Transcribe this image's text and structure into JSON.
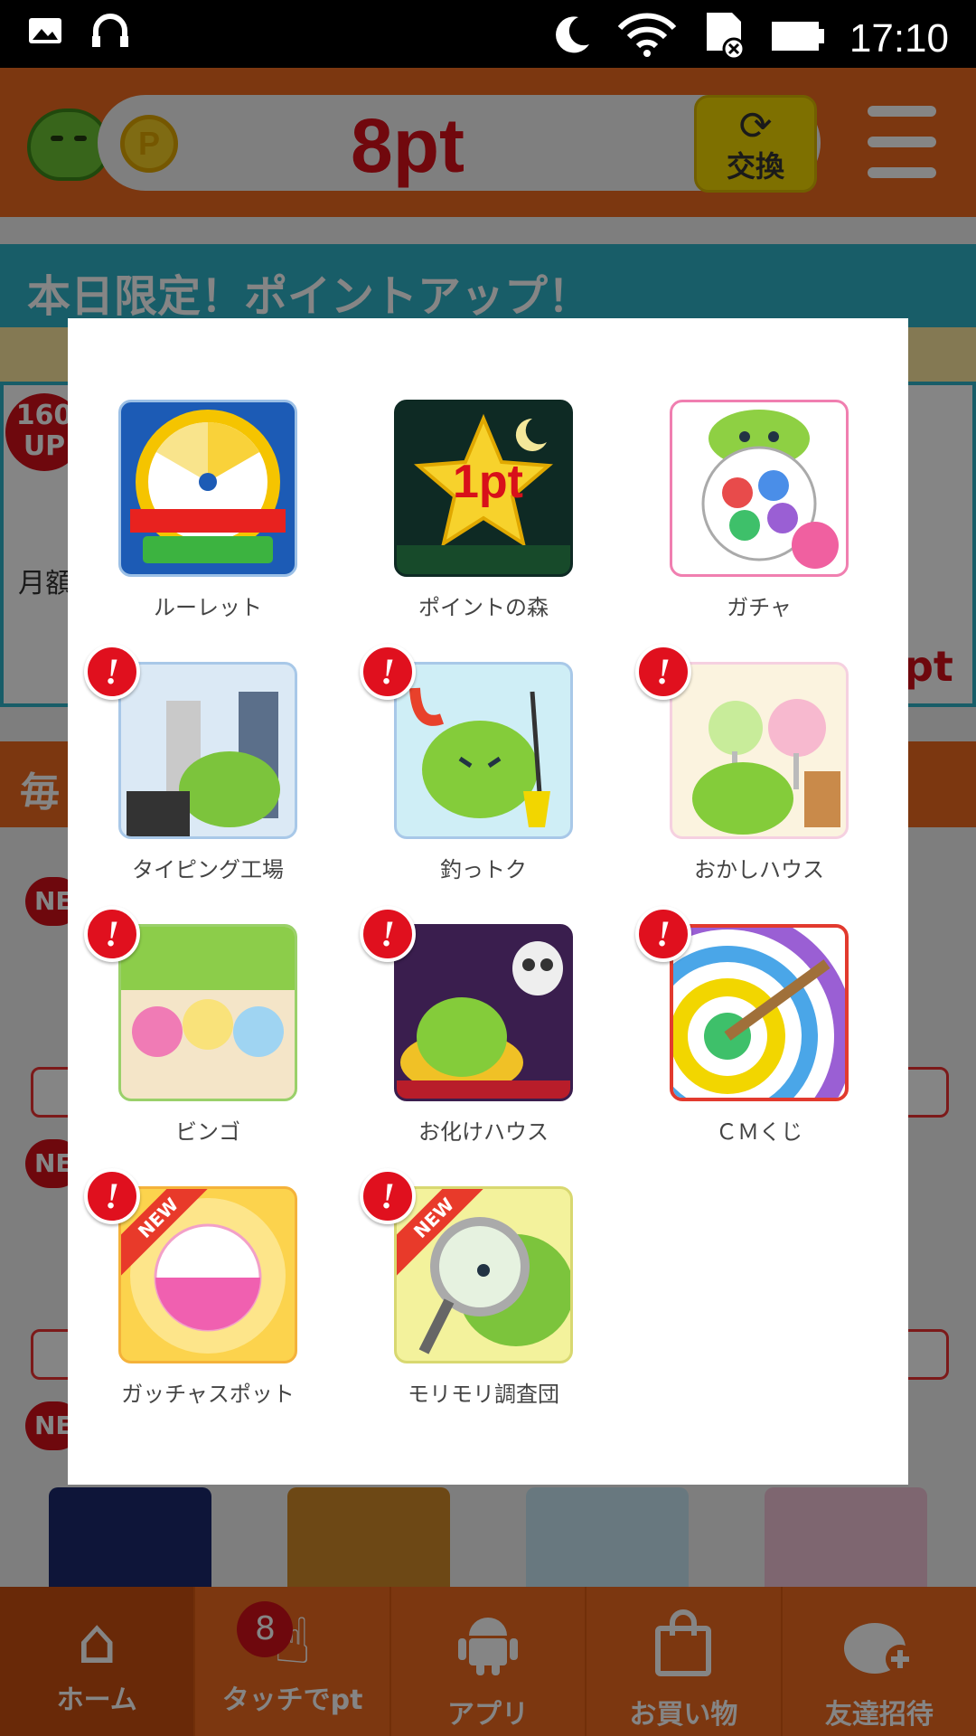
{
  "status_bar": {
    "time": "17:10"
  },
  "header": {
    "points": "8pt",
    "coin_symbol": "P",
    "exchange_label": "交換"
  },
  "background": {
    "banner_title": "本日限定！ポイントアップ！",
    "badge_160": "160\nUP",
    "monthly_text": "月額",
    "section2_title": "毎",
    "pt_fragment": "pt",
    "new_badge": "NE"
  },
  "modal": {
    "items": [
      {
        "label": "ルーレット",
        "alert": false,
        "new": false,
        "colors": [
          "#1c5bb5",
          "#f5c400"
        ]
      },
      {
        "label": "ポイントの森",
        "alert": false,
        "new": false,
        "colors": [
          "#0e2a24",
          "#f7d22c"
        ],
        "badge_text": "1pt"
      },
      {
        "label": "ガチャ",
        "alert": false,
        "new": false,
        "colors": [
          "#ffffff",
          "#8ed043"
        ]
      },
      {
        "label": "タイピング工場",
        "alert": true,
        "new": false,
        "colors": [
          "#dbe9f5",
          "#7cc43c"
        ]
      },
      {
        "label": "釣っトク",
        "alert": true,
        "new": false,
        "colors": [
          "#cfeef6",
          "#84cc3a"
        ]
      },
      {
        "label": "おかしハウス",
        "alert": true,
        "new": false,
        "colors": [
          "#fbf3df",
          "#f3a6c6"
        ]
      },
      {
        "label": "ビンゴ",
        "alert": true,
        "new": false,
        "colors": [
          "#8ccd4a",
          "#f4e5c8"
        ]
      },
      {
        "label": "お化けハウス",
        "alert": true,
        "new": false,
        "colors": [
          "#3a1e4e",
          "#f0c126"
        ]
      },
      {
        "label": "ＣＭくじ",
        "alert": true,
        "new": false,
        "colors": [
          "#e8a93e",
          "#e23a2e"
        ]
      },
      {
        "label": "ガッチャスポット",
        "alert": true,
        "new": true,
        "colors": [
          "#fcd34d",
          "#f060b0"
        ]
      },
      {
        "label": "モリモリ調査団",
        "alert": true,
        "new": true,
        "colors": [
          "#f3f29c",
          "#7cc43c"
        ]
      }
    ],
    "alert_mark": "!",
    "new_label": "NEW"
  },
  "bottom_nav": {
    "items": [
      {
        "label": "ホーム",
        "icon": "home-icon",
        "active": true
      },
      {
        "label": "タッチでpt",
        "icon": "touch-icon",
        "badge": "8"
      },
      {
        "label": "アプリ",
        "icon": "android-icon"
      },
      {
        "label": "お買い物",
        "icon": "shopping-bag-icon"
      },
      {
        "label": "友達招待",
        "icon": "invite-friend-icon"
      }
    ]
  }
}
